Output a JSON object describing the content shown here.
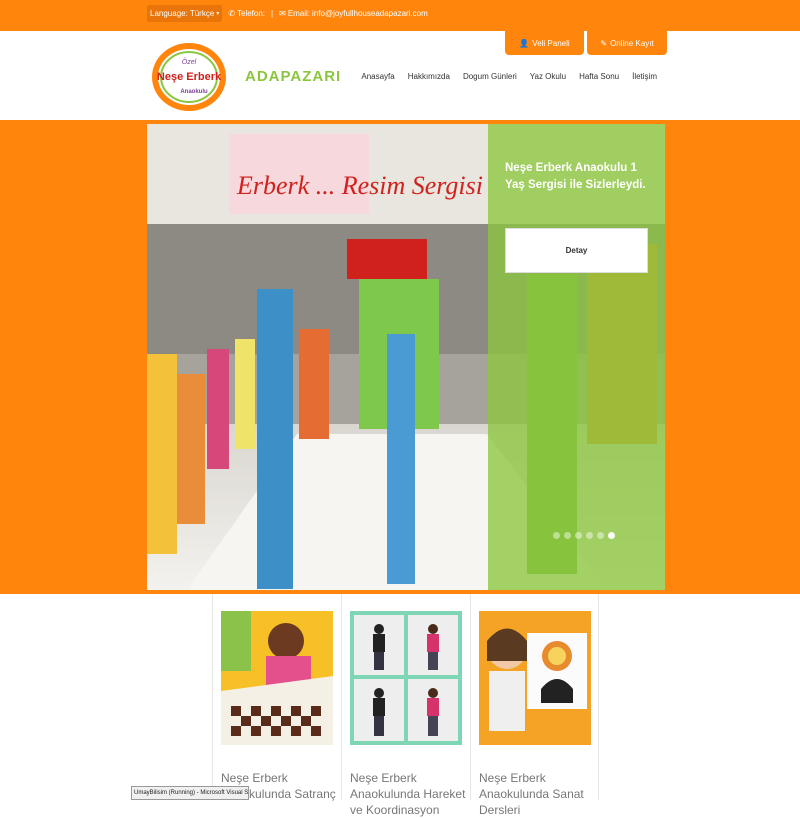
{
  "topbar": {
    "language_label": "Language:",
    "language_value": "Türkçe",
    "phone_label": "Telefon:",
    "email_label": "Email:",
    "email_value": "info@joyfullhouseadapazari.com"
  },
  "header": {
    "logo_line1": "Özel",
    "logo_line2": "Neşe Erberk",
    "logo_line3": "Anaokulu",
    "city": "ADAPAZARI",
    "btn_veli": "Veli Paneli",
    "btn_kayit": "Online Kayıt",
    "nav": [
      "Anasayfa",
      "Hakkımızda",
      "Dogum Günleri",
      "Yaz Okulu",
      "Hafta Sonu",
      "İletişim"
    ]
  },
  "slider": {
    "banner_text": "Erberk ... Resim Sergisi",
    "title": "Neşe Erberk Anaokulu 1 Yaş Sergisi ile Sizlerleydi.",
    "button": "Detay",
    "slide_count": 6,
    "active_slide": 5
  },
  "cards": [
    {
      "title": "Neşe Erberk Anaokulunda Satranç"
    },
    {
      "title": "Neşe Erberk Anaokulunda Hareket ve Koordinasyon"
    },
    {
      "title": "Neşe Erberk Anaokulunda Sanat Dersleri"
    }
  ],
  "taskbar": {
    "label": "UmayBilisim (Running) - Microsoft Visual Studio"
  },
  "colors": {
    "brand_orange": "#ff850d",
    "brand_green": "#8cc63e"
  }
}
